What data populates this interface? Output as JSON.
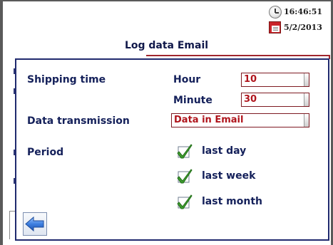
{
  "status": {
    "time": "16:46:51",
    "date": "5/2/2013"
  },
  "page_title": "Log data Email",
  "dialog": {
    "shipping_time_label": "Shipping time",
    "hour_label": "Hour",
    "hour_value": "10",
    "minute_label": "Minute",
    "minute_value": "30",
    "data_transmission_label": "Data transmission",
    "data_transmission_value": "Data in Email",
    "period_label": "Period",
    "period_options": [
      {
        "label": "last day",
        "checked": true
      },
      {
        "label": "last week",
        "checked": true
      },
      {
        "label": "last month",
        "checked": true
      }
    ]
  },
  "icons": {
    "clock": "clock-icon",
    "calendar": "calendar-icon",
    "check": "checkmark-icon",
    "back": "back-arrow-icon"
  },
  "colors": {
    "label_text": "#14205a",
    "field_text": "#b0141c",
    "field_border": "#7e1a22",
    "dialog_border": "#202a6e",
    "check_green": "#3e9b2e",
    "back_arrow_blue": "#2f6fd1"
  }
}
